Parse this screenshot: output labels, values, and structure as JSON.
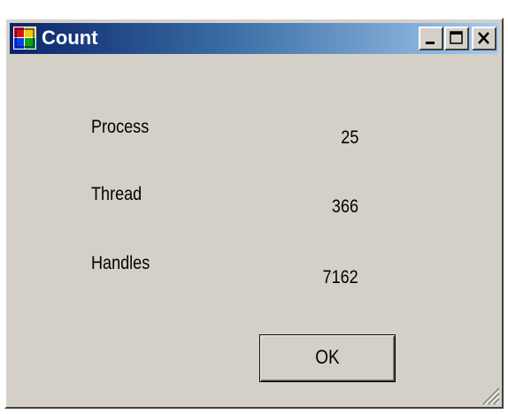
{
  "window": {
    "title": "Count"
  },
  "rows": [
    {
      "label": "Process",
      "value": "25"
    },
    {
      "label": "Thread",
      "value": "366"
    },
    {
      "label": "Handles",
      "value": "7162"
    }
  ],
  "buttons": {
    "ok_label": "OK"
  },
  "icons": {
    "app": "app-icon",
    "minimize": "minimize-icon",
    "maximize": "maximize-icon",
    "close": "close-icon",
    "resize": "resize-grip-icon"
  },
  "colors": {
    "window_bg": "#d4d0c8",
    "titlebar_start": "#0a246a",
    "titlebar_end": "#a6caf0"
  }
}
